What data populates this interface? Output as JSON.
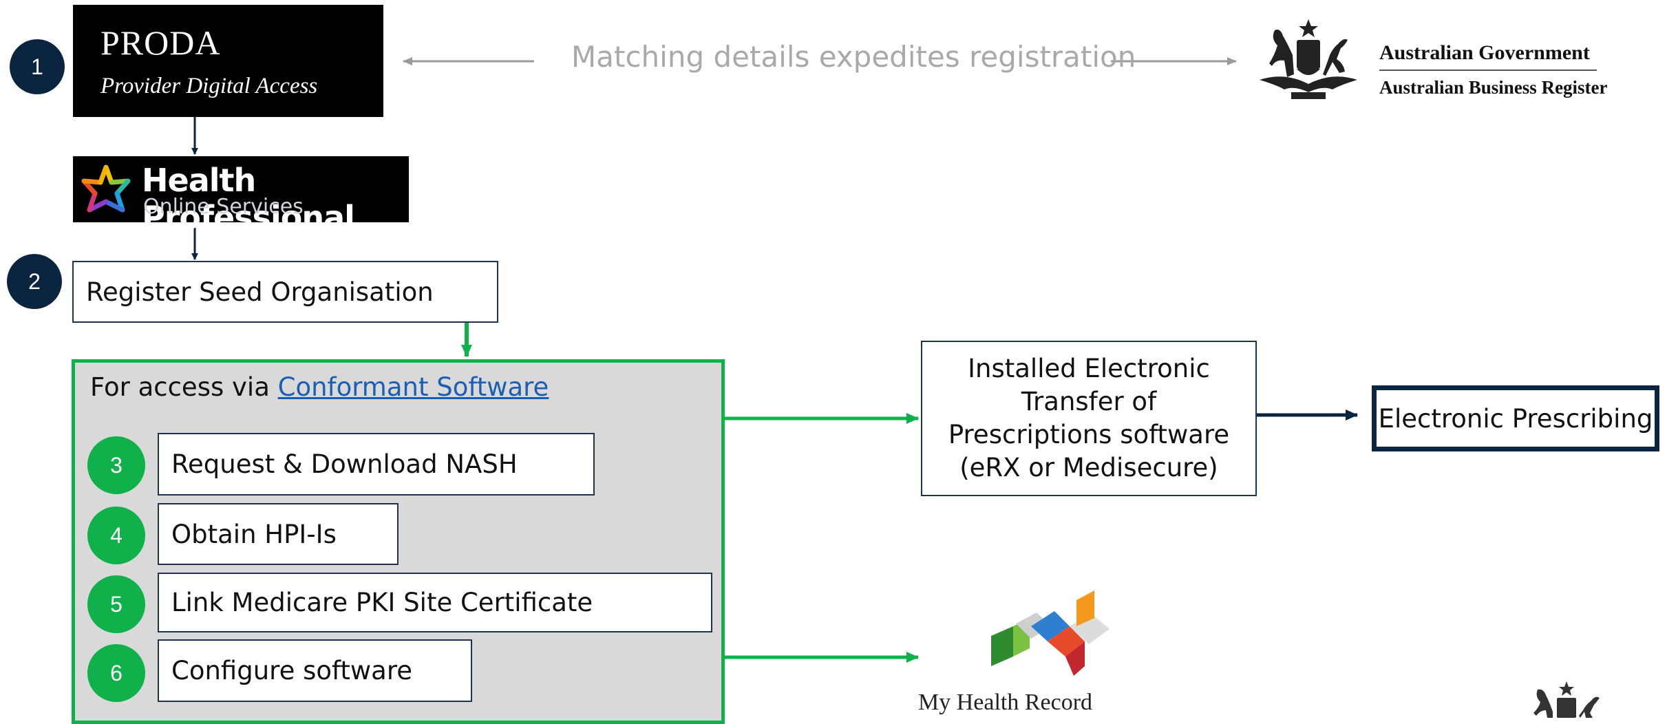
{
  "proda": {
    "title": "PRODA",
    "subtitle": "Provider Digital Access"
  },
  "hpos": {
    "title": "Health Professional",
    "subtitle": "Online Services"
  },
  "matching_text": "Matching details expedites registration",
  "abr": {
    "line1": "Australian Government",
    "line2": "Australian Business Register"
  },
  "steps": {
    "s1": {
      "number": "1"
    },
    "s2": {
      "number": "2",
      "label": "Register Seed Organisation"
    },
    "s3": {
      "number": "3",
      "label": "Request & Download NASH"
    },
    "s4": {
      "number": "4",
      "label": "Obtain HPI-Is"
    },
    "s5": {
      "number": "5",
      "label": "Link Medicare PKI Site Certificate"
    },
    "s6": {
      "number": "6",
      "label": "Configure software"
    }
  },
  "access": {
    "prefix": "For access via ",
    "link": "Conformant Software"
  },
  "etp_box": "Installed Electronic Transfer of Prescriptions software (eRX or Medisecure)",
  "eprescribing": "Electronic Prescribing",
  "mhr_label": "My Health Record",
  "colors": {
    "navy": "#0b2540",
    "green": "#10b04a",
    "panel": "#d9d9d9",
    "link": "#1a5fb4"
  },
  "icons": [
    "coat-of-arms-icon",
    "hpos-star-icon",
    "my-health-record-logo-icon"
  ]
}
